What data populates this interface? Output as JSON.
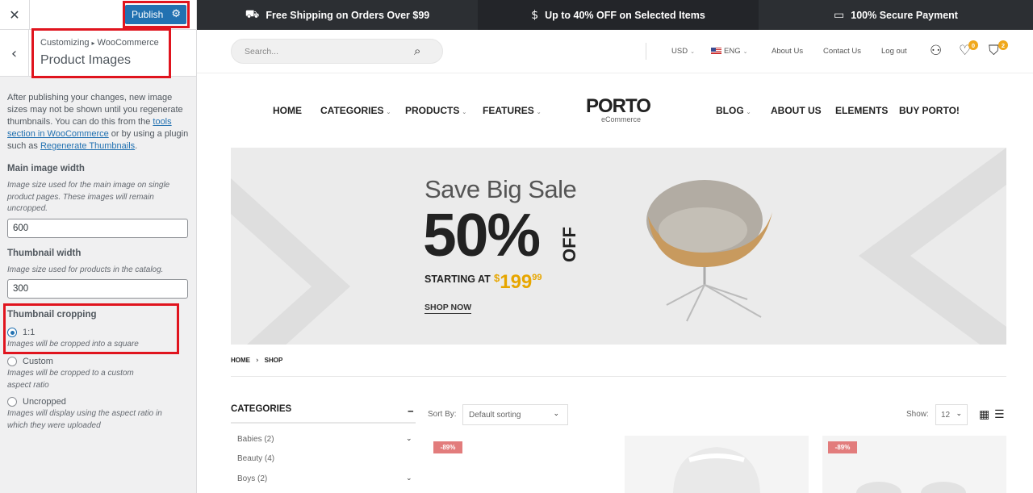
{
  "customizer": {
    "close_label": "✕",
    "publish_label": "Publish",
    "breadcrumb_parent": "Customizing",
    "breadcrumb_child": "WooCommerce",
    "section_title": "Product Images",
    "intro_text_1": "After publishing your changes, new image sizes may not be shown until you regenerate thumbnails. You can do this from the ",
    "intro_link_1": "tools section in WooCommerce",
    "intro_text_2": " or by using a plugin such as ",
    "intro_link_2": "Regenerate Thumbnails",
    "intro_text_3": ".",
    "main_image": {
      "title": "Main image width",
      "description": "Image size used for the main image on single product pages. These images will remain uncropped.",
      "value": "600"
    },
    "thumbnail": {
      "title": "Thumbnail width",
      "description": "Image size used for products in the catalog.",
      "value": "300"
    },
    "cropping": {
      "title": "Thumbnail cropping",
      "options": [
        {
          "label": "1:1",
          "description": "Images will be cropped into a square",
          "checked": true
        },
        {
          "label": "Custom",
          "description": "Images will be cropped to a custom aspect ratio",
          "checked": false
        },
        {
          "label": "Uncropped",
          "description": "Images will display using the aspect ratio in which they were uploaded",
          "checked": false
        }
      ]
    }
  },
  "promo_bar": [
    {
      "icon": "truck-icon",
      "text": "Free Shipping on Orders Over $99"
    },
    {
      "icon": "dollar-icon",
      "text": "Up to 40% OFF on Selected Items"
    },
    {
      "icon": "card-icon",
      "text": "100% Secure Payment"
    }
  ],
  "header": {
    "search_placeholder": "Search...",
    "currency": "USD",
    "language": "ENG",
    "links": [
      "About Us",
      "Contact Us",
      "Log out"
    ],
    "wishlist_count": "0",
    "cart_count": "2"
  },
  "nav": {
    "left": [
      "HOME",
      "CATEGORIES",
      "PRODUCTS",
      "FEATURES"
    ],
    "logo": "PORTO",
    "logo_sub": "eCommerce",
    "right": [
      "BLOG",
      "ABOUT US",
      "ELEMENTS",
      "BUY PORTO!"
    ]
  },
  "banner": {
    "headline": "Save Big Sale",
    "percent": "50%",
    "off": "OFF",
    "starting_at": "STARTING AT",
    "price_currency": "$",
    "price_whole": "199",
    "price_cents": "99",
    "cta": "SHOP NOW"
  },
  "breadcrumb": [
    "HOME",
    "SHOP"
  ],
  "sidebar": {
    "title": "CATEGORIES",
    "items": [
      "Babies (2)",
      "Beauty (4)",
      "Boys (2)"
    ]
  },
  "toolbar": {
    "sort_label": "Sort By:",
    "sort_value": "Default sorting",
    "show_label": "Show:",
    "show_value": "12"
  },
  "products": [
    {
      "badge": "-89%"
    },
    {
      "badge": ""
    },
    {
      "badge": "-89%"
    }
  ],
  "colors": {
    "accent_blue": "#2271b1",
    "highlight_red": "#e0141e",
    "price_gold": "#e7a600",
    "badge_orange": "#f0a81c",
    "sale_badge": "#e27c7c"
  }
}
